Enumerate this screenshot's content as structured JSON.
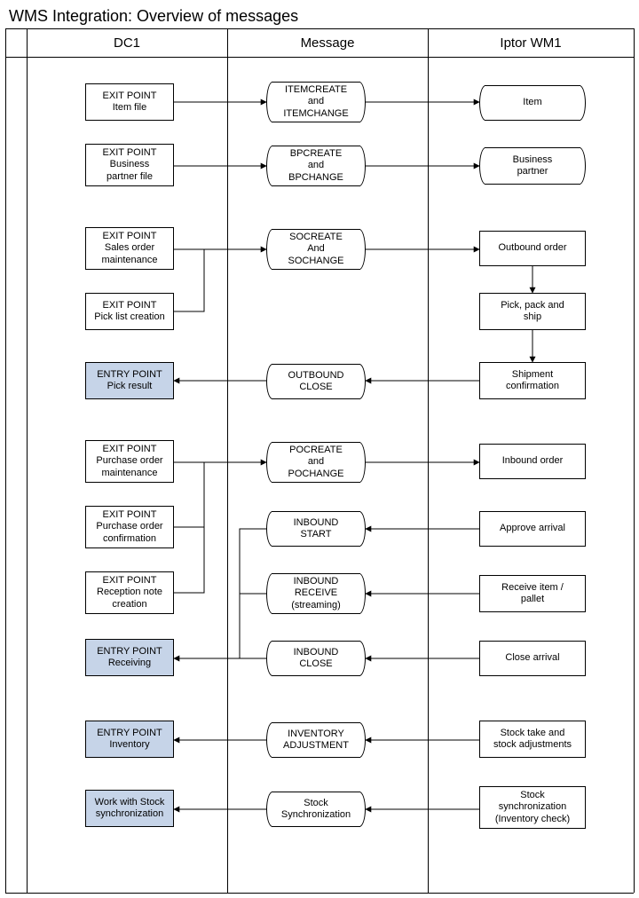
{
  "title": "WMS Integration: Overview of messages",
  "columns": {
    "dc1": "DC1",
    "message": "Message",
    "iptor": "Iptor WM1"
  },
  "dc1": {
    "itemfile": {
      "l1": "EXIT POINT",
      "l2": "Item file"
    },
    "bpfile": {
      "l1": "EXIT POINT",
      "l2": "Business",
      "l3": "partner file"
    },
    "somaint": {
      "l1": "EXIT POINT",
      "l2": "Sales order",
      "l3": "maintenance"
    },
    "picklist": {
      "l1": "EXIT POINT",
      "l2": "Pick list creation"
    },
    "pickresult": {
      "l1": "ENTRY POINT",
      "l2": "Pick result"
    },
    "pomaint": {
      "l1": "EXIT POINT",
      "l2": "Purchase order",
      "l3": "maintenance"
    },
    "poconfirm": {
      "l1": "EXIT POINT",
      "l2": "Purchase order",
      "l3": "confirmation"
    },
    "recnote": {
      "l1": "EXIT POINT",
      "l2": "Reception note",
      "l3": "creation"
    },
    "receiving": {
      "l1": "ENTRY POINT",
      "l2": "Receiving"
    },
    "inventory": {
      "l1": "ENTRY POINT",
      "l2": "Inventory"
    },
    "stocksync": {
      "l1": "Work with Stock",
      "l2": "synchronization"
    }
  },
  "msg": {
    "item": {
      "l1": "ITEMCREATE",
      "l2": "and",
      "l3": "ITEMCHANGE"
    },
    "bp": {
      "l1": "BPCREATE",
      "l2": "and",
      "l3": "BPCHANGE"
    },
    "so": {
      "l1": "SOCREATE",
      "l2": "And",
      "l3": "SOCHANGE"
    },
    "outclose": {
      "l1": "OUTBOUND",
      "l2": "CLOSE"
    },
    "po": {
      "l1": "POCREATE",
      "l2": "and",
      "l3": "POCHANGE"
    },
    "instart": {
      "l1": "INBOUND",
      "l2": "START"
    },
    "inrecv": {
      "l1": "INBOUND",
      "l2": "RECEIVE",
      "l3": "(streaming)"
    },
    "inclose": {
      "l1": "INBOUND",
      "l2": "CLOSE"
    },
    "invadj": {
      "l1": "INVENTORY",
      "l2": "ADJUSTMENT"
    },
    "stksync": {
      "l1": "Stock",
      "l2": "Synchronization"
    }
  },
  "wm1": {
    "item": "Item",
    "bp": {
      "l1": "Business",
      "l2": "partner"
    },
    "outorder": "Outbound order",
    "ppship": {
      "l1": "Pick, pack and",
      "l2": "ship"
    },
    "shipconf": {
      "l1": "Shipment",
      "l2": "confirmation"
    },
    "inorder": "Inbound order",
    "apprarr": "Approve arrival",
    "recvitem": {
      "l1": "Receive item /",
      "l2": "pallet"
    },
    "closearr": "Close arrival",
    "stktake": {
      "l1": "Stock take and",
      "l2": "stock adjustments"
    },
    "stksync": {
      "l1": "Stock",
      "l2": "synchronization",
      "l3": "(Inventory check)"
    }
  }
}
